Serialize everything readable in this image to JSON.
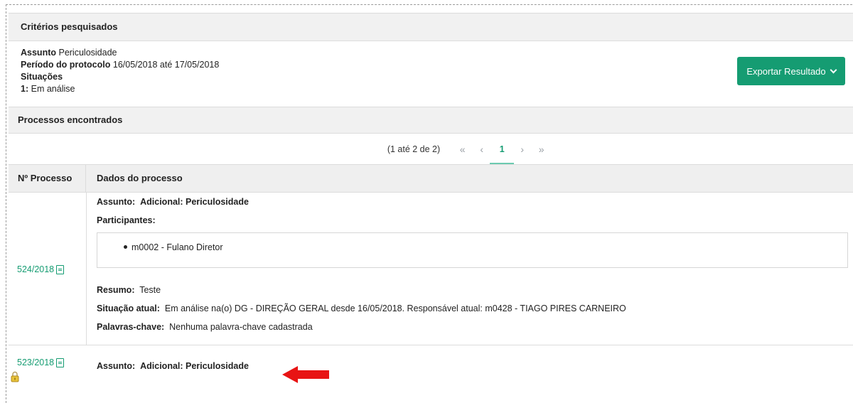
{
  "criteria": {
    "header": "Critérios pesquisados",
    "assunto_label": "Assunto",
    "assunto_value": "Periculosidade",
    "periodo_label": "Período do protocolo",
    "periodo_value": "16/05/2018 até 17/05/2018",
    "situacoes_label": "Situações",
    "situacao_item_num": "1:",
    "situacao_item_value": "Em análise"
  },
  "export_button": {
    "label": "Exportar Resultado"
  },
  "results": {
    "header": "Processos encontrados",
    "pagination": {
      "count_text": "(1 até 2 de 2)",
      "first": "«",
      "prev": "‹",
      "current_page": "1",
      "next": "›",
      "last": "»"
    },
    "columns": {
      "num": "Nº Processo",
      "data": "Dados do processo"
    },
    "rows": [
      {
        "number": "524/2018",
        "assunto_label": "Assunto:",
        "assunto_value": "Adicional: Periculosidade",
        "participantes_label": "Participantes:",
        "participants": [
          "m0002 - Fulano Diretor"
        ],
        "resumo_label": "Resumo:",
        "resumo_value": "Teste",
        "situacao_label": "Situação atual:",
        "situacao_value": "Em análise na(o) DG - DIREÇÃO GERAL desde 16/05/2018. Responsável atual: m0428 - TIAGO PIRES CARNEIRO",
        "palavras_label": "Palavras-chave:",
        "palavras_value": "Nenhuma palavra-chave cadastrada"
      },
      {
        "number": "523/2018",
        "assunto_label": "Assunto:",
        "assunto_value": "Adicional: Periculosidade"
      }
    ]
  },
  "icons": {
    "pdf": "pdf-icon",
    "lock": "lock-icon",
    "arrow": "red-arrow-icon"
  },
  "colors": {
    "accent": "#159c72",
    "arrow": "#e81414",
    "lock": "#e8c33a"
  }
}
